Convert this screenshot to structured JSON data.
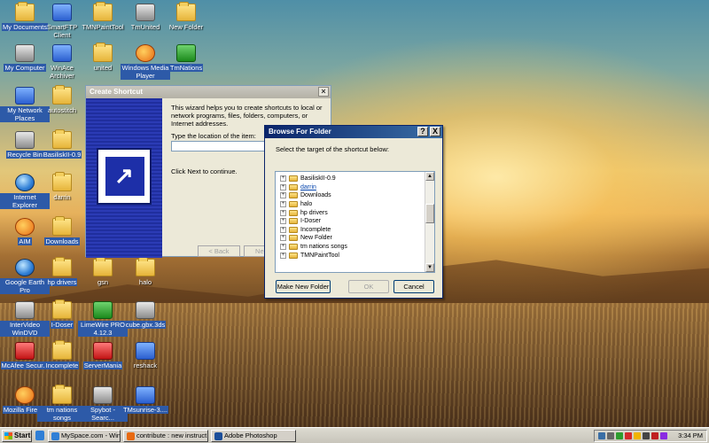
{
  "desktop_icons": [
    {
      "label": "My Documents",
      "icon": "my-documents-icon"
    },
    {
      "label": "SmartFTP Client",
      "icon": "smartftp-icon"
    },
    {
      "label": "TMNPaintTool",
      "icon": "folder-icon"
    },
    {
      "label": "TmUnited",
      "icon": "tmunited-icon"
    },
    {
      "label": "New Folder",
      "icon": "folder-icon"
    },
    {
      "label": "My Computer",
      "icon": "my-computer-icon"
    },
    {
      "label": "WinAce Archiver",
      "icon": "winace-icon"
    },
    {
      "label": "united",
      "icon": "folder-icon"
    },
    {
      "label": "Windows Media Player",
      "icon": "media-player-icon"
    },
    {
      "label": "TmNations",
      "icon": "tmnations-icon"
    },
    {
      "label": "My Network Places",
      "icon": "network-places-icon"
    },
    {
      "label": "autostitch",
      "icon": "folder-icon"
    },
    {
      "label": "Recycle Bin",
      "icon": "recycle-bin-icon"
    },
    {
      "label": "BasiliskII-0.9",
      "icon": "folder-icon"
    },
    {
      "label": "Internet Explorer",
      "icon": "internet-explorer-icon"
    },
    {
      "label": "darrin",
      "icon": "folder-icon"
    },
    {
      "label": "AIM",
      "icon": "aim-icon"
    },
    {
      "label": "Downloads",
      "icon": "folder-icon"
    },
    {
      "label": "Google Earth Pro",
      "icon": "google-earth-icon"
    },
    {
      "label": "hp drivers",
      "icon": "folder-icon"
    },
    {
      "label": "gsn",
      "icon": "folder-icon"
    },
    {
      "label": "halo",
      "icon": "folder-icon"
    },
    {
      "label": "InterVideo WinDVD",
      "icon": "windvd-icon"
    },
    {
      "label": "I-Doser",
      "icon": "folder-icon"
    },
    {
      "label": "LimeWire PRO 4.12.3",
      "icon": "limewire-icon"
    },
    {
      "label": "cube.gbx.3ds",
      "icon": "file-icon"
    },
    {
      "label": "McAfee Secur...",
      "icon": "mcafee-icon"
    },
    {
      "label": "Incomplete",
      "icon": "folder-icon"
    },
    {
      "label": "ServerMania",
      "icon": "servermania-icon"
    },
    {
      "label": "reshack",
      "icon": "reshack-icon"
    },
    {
      "label": "Mozilla Firefox",
      "icon": "firefox-icon"
    },
    {
      "label": "tm nations songs",
      "icon": "folder-icon"
    },
    {
      "label": "Spybot - Searc...",
      "icon": "spybot-icon"
    },
    {
      "label": "TMsunrise-3....",
      "icon": "tmsunrise-icon"
    }
  ],
  "create_shortcut": {
    "title": "Create Shortcut",
    "intro": "This wizard helps you to create shortcuts to local or network programs, files, folders, computers, or Internet addresses.",
    "location_label": "Type the location of the item:",
    "location_value": "",
    "continue_text": "Click Next to continue.",
    "back_label": "< Back",
    "next_label": "Next >"
  },
  "browse_folder": {
    "title": "Browse For Folder",
    "help_label": "?",
    "close_label": "X",
    "prompt": "Select the target of the shortcut below:",
    "items": [
      {
        "name": "BasiliskII-0.9",
        "link": false
      },
      {
        "name": "darrin",
        "link": true
      },
      {
        "name": "Downloads",
        "link": false
      },
      {
        "name": "halo",
        "link": false
      },
      {
        "name": "hp drivers",
        "link": false
      },
      {
        "name": "I-Doser",
        "link": false
      },
      {
        "name": "Incomplete",
        "link": false
      },
      {
        "name": "New Folder",
        "link": false
      },
      {
        "name": "tm nations songs",
        "link": false
      },
      {
        "name": "TMNPaintTool",
        "link": false
      }
    ],
    "make_new_folder_label": "Make New Folder",
    "ok_label": "OK",
    "cancel_label": "Cancel"
  },
  "taskbar": {
    "start_label": "Start",
    "tasks": [
      {
        "label": "MySpace.com - Windows...",
        "icon": "ie-icon"
      },
      {
        "label": "contribute : new instruct...",
        "icon": "firefox-icon"
      },
      {
        "label": "Adobe Photoshop",
        "icon": "photoshop-icon"
      }
    ],
    "clock": "3:34 PM"
  }
}
